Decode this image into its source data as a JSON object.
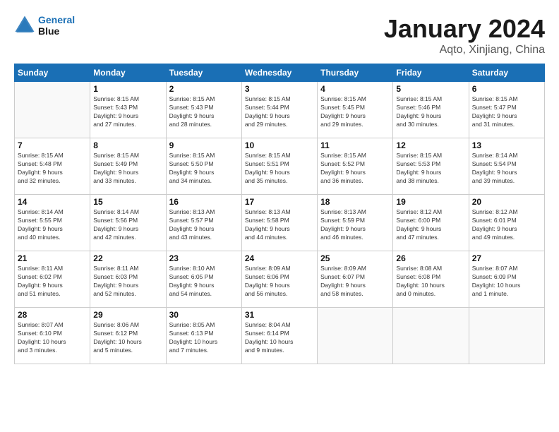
{
  "header": {
    "logo_line1": "General",
    "logo_line2": "Blue",
    "title": "January 2024",
    "subtitle": "Aqto, Xinjiang, China"
  },
  "weekdays": [
    "Sunday",
    "Monday",
    "Tuesday",
    "Wednesday",
    "Thursday",
    "Friday",
    "Saturday"
  ],
  "weeks": [
    [
      {
        "day": "",
        "info": ""
      },
      {
        "day": "1",
        "info": "Sunrise: 8:15 AM\nSunset: 5:43 PM\nDaylight: 9 hours\nand 27 minutes."
      },
      {
        "day": "2",
        "info": "Sunrise: 8:15 AM\nSunset: 5:43 PM\nDaylight: 9 hours\nand 28 minutes."
      },
      {
        "day": "3",
        "info": "Sunrise: 8:15 AM\nSunset: 5:44 PM\nDaylight: 9 hours\nand 29 minutes."
      },
      {
        "day": "4",
        "info": "Sunrise: 8:15 AM\nSunset: 5:45 PM\nDaylight: 9 hours\nand 29 minutes."
      },
      {
        "day": "5",
        "info": "Sunrise: 8:15 AM\nSunset: 5:46 PM\nDaylight: 9 hours\nand 30 minutes."
      },
      {
        "day": "6",
        "info": "Sunrise: 8:15 AM\nSunset: 5:47 PM\nDaylight: 9 hours\nand 31 minutes."
      }
    ],
    [
      {
        "day": "7",
        "info": "Sunrise: 8:15 AM\nSunset: 5:48 PM\nDaylight: 9 hours\nand 32 minutes."
      },
      {
        "day": "8",
        "info": "Sunrise: 8:15 AM\nSunset: 5:49 PM\nDaylight: 9 hours\nand 33 minutes."
      },
      {
        "day": "9",
        "info": "Sunrise: 8:15 AM\nSunset: 5:50 PM\nDaylight: 9 hours\nand 34 minutes."
      },
      {
        "day": "10",
        "info": "Sunrise: 8:15 AM\nSunset: 5:51 PM\nDaylight: 9 hours\nand 35 minutes."
      },
      {
        "day": "11",
        "info": "Sunrise: 8:15 AM\nSunset: 5:52 PM\nDaylight: 9 hours\nand 36 minutes."
      },
      {
        "day": "12",
        "info": "Sunrise: 8:15 AM\nSunset: 5:53 PM\nDaylight: 9 hours\nand 38 minutes."
      },
      {
        "day": "13",
        "info": "Sunrise: 8:14 AM\nSunset: 5:54 PM\nDaylight: 9 hours\nand 39 minutes."
      }
    ],
    [
      {
        "day": "14",
        "info": "Sunrise: 8:14 AM\nSunset: 5:55 PM\nDaylight: 9 hours\nand 40 minutes."
      },
      {
        "day": "15",
        "info": "Sunrise: 8:14 AM\nSunset: 5:56 PM\nDaylight: 9 hours\nand 42 minutes."
      },
      {
        "day": "16",
        "info": "Sunrise: 8:13 AM\nSunset: 5:57 PM\nDaylight: 9 hours\nand 43 minutes."
      },
      {
        "day": "17",
        "info": "Sunrise: 8:13 AM\nSunset: 5:58 PM\nDaylight: 9 hours\nand 44 minutes."
      },
      {
        "day": "18",
        "info": "Sunrise: 8:13 AM\nSunset: 5:59 PM\nDaylight: 9 hours\nand 46 minutes."
      },
      {
        "day": "19",
        "info": "Sunrise: 8:12 AM\nSunset: 6:00 PM\nDaylight: 9 hours\nand 47 minutes."
      },
      {
        "day": "20",
        "info": "Sunrise: 8:12 AM\nSunset: 6:01 PM\nDaylight: 9 hours\nand 49 minutes."
      }
    ],
    [
      {
        "day": "21",
        "info": "Sunrise: 8:11 AM\nSunset: 6:02 PM\nDaylight: 9 hours\nand 51 minutes."
      },
      {
        "day": "22",
        "info": "Sunrise: 8:11 AM\nSunset: 6:03 PM\nDaylight: 9 hours\nand 52 minutes."
      },
      {
        "day": "23",
        "info": "Sunrise: 8:10 AM\nSunset: 6:05 PM\nDaylight: 9 hours\nand 54 minutes."
      },
      {
        "day": "24",
        "info": "Sunrise: 8:09 AM\nSunset: 6:06 PM\nDaylight: 9 hours\nand 56 minutes."
      },
      {
        "day": "25",
        "info": "Sunrise: 8:09 AM\nSunset: 6:07 PM\nDaylight: 9 hours\nand 58 minutes."
      },
      {
        "day": "26",
        "info": "Sunrise: 8:08 AM\nSunset: 6:08 PM\nDaylight: 10 hours\nand 0 minutes."
      },
      {
        "day": "27",
        "info": "Sunrise: 8:07 AM\nSunset: 6:09 PM\nDaylight: 10 hours\nand 1 minute."
      }
    ],
    [
      {
        "day": "28",
        "info": "Sunrise: 8:07 AM\nSunset: 6:10 PM\nDaylight: 10 hours\nand 3 minutes."
      },
      {
        "day": "29",
        "info": "Sunrise: 8:06 AM\nSunset: 6:12 PM\nDaylight: 10 hours\nand 5 minutes."
      },
      {
        "day": "30",
        "info": "Sunrise: 8:05 AM\nSunset: 6:13 PM\nDaylight: 10 hours\nand 7 minutes."
      },
      {
        "day": "31",
        "info": "Sunrise: 8:04 AM\nSunset: 6:14 PM\nDaylight: 10 hours\nand 9 minutes."
      },
      {
        "day": "",
        "info": ""
      },
      {
        "day": "",
        "info": ""
      },
      {
        "day": "",
        "info": ""
      }
    ]
  ]
}
